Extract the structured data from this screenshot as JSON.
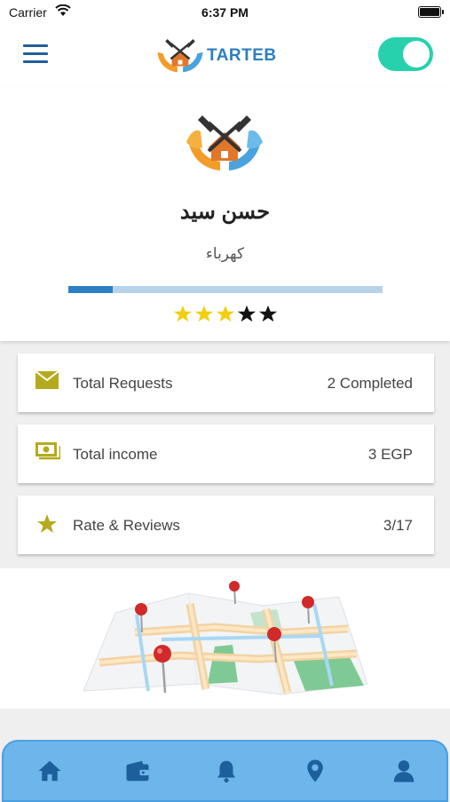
{
  "status_bar": {
    "carrier": "Carrier",
    "time": "6:37 PM"
  },
  "header": {
    "brand": "TARTEB",
    "availability_toggle_on": true
  },
  "profile": {
    "name": "حسن سيد",
    "role": "كهرباء",
    "progress_fraction": 0.14,
    "rating_stars_filled": 3,
    "rating_stars_total": 5
  },
  "stats": [
    {
      "label": "Total Requests",
      "value": "2 Completed",
      "icon": "envelope-icon"
    },
    {
      "label": "Total income",
      "value": "3 EGP",
      "icon": "cash-icon"
    },
    {
      "label": "Rate & Reviews",
      "value": "3/17",
      "icon": "star-icon"
    }
  ],
  "tabs": [
    {
      "icon": "home-icon"
    },
    {
      "icon": "wallet-icon"
    },
    {
      "icon": "bell-icon"
    },
    {
      "icon": "map-pin-icon"
    },
    {
      "icon": "user-icon"
    }
  ],
  "colors": {
    "accent_blue": "#2b7fc1",
    "toggle_green": "#27d1ae",
    "stat_icon": "#b5aa1d",
    "tab_bar": "#6cb6ec",
    "tab_icon": "#1d5f9a",
    "star_filled": "#f2cf0f",
    "star_empty": "#111111"
  }
}
